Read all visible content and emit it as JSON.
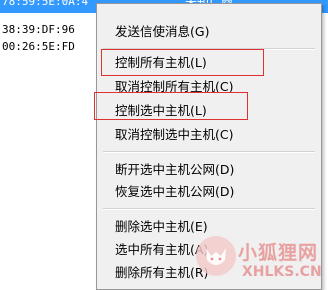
{
  "table": {
    "rows": [
      {
        "mac": "78:59:5E:0A:4",
        "vendor": "未知厂商",
        "selected": true
      },
      {
        "mac": "38:39:DF:96",
        "vendor": "",
        "selected": false
      },
      {
        "mac": "00:26:5E:FD",
        "vendor": "",
        "selected": false
      }
    ]
  },
  "context_menu": {
    "items": [
      {
        "label": "发送信使消息(G)",
        "highlighted": false
      },
      {
        "label": "控制所有主机(L)",
        "highlighted": true
      },
      {
        "label": "取消控制所有主机(C)",
        "highlighted": false
      },
      {
        "label": "控制选中主机(L)",
        "highlighted": true
      },
      {
        "label": "取消控制选中主机(C)",
        "highlighted": false
      },
      {
        "label": "断开选中主机公网(D)",
        "highlighted": false
      },
      {
        "label": "恢复选中主机公网(D)",
        "highlighted": false
      },
      {
        "label": "删除选中主机(E)",
        "highlighted": false
      },
      {
        "label": "选中所有主机(A)",
        "highlighted": false
      },
      {
        "label": "删除所有主机(R)",
        "highlighted": false
      }
    ],
    "highlight_color": "#e03131"
  },
  "watermark": {
    "cn": "小狐狸网",
    "en": "XHLKS.CN",
    "icon": "fox-logo-icon",
    "color": "#e79393"
  }
}
